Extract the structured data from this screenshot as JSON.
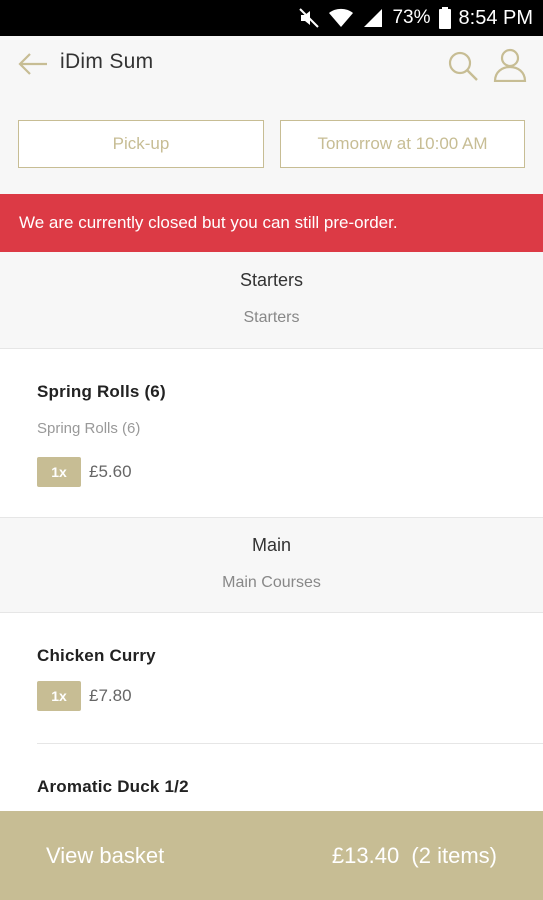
{
  "status_bar": {
    "battery_percent": "73%",
    "time": "8:54 PM"
  },
  "app_bar": {
    "title": "iDim Sum"
  },
  "order_options": {
    "mode": "Pick-up",
    "time": "Tomorrow at 10:00 AM"
  },
  "alert": {
    "message": "We are currently closed but you can still pre-order."
  },
  "menu": {
    "sections": [
      {
        "title": "Starters",
        "subtitle": "Starters",
        "items": [
          {
            "name": "Spring Rolls (6)",
            "description": "Spring Rolls (6)",
            "quantity": "1x",
            "price": "£5.60"
          }
        ]
      },
      {
        "title": "Main",
        "subtitle": "Main Courses",
        "items": [
          {
            "name": "Chicken Curry",
            "quantity": "1x",
            "price": "£7.80"
          },
          {
            "name": "Aromatic Duck 1/2"
          }
        ]
      }
    ]
  },
  "basket": {
    "label": "View basket",
    "total": "£13.40  (2 items)"
  },
  "colors": {
    "accent": "#c7bd94",
    "alert": "#dc3a45",
    "status_bar": "#000000"
  },
  "icons": [
    "mute-icon",
    "wifi-icon",
    "signal-icon",
    "battery-icon",
    "back-arrow-icon",
    "search-icon",
    "user-icon"
  ]
}
